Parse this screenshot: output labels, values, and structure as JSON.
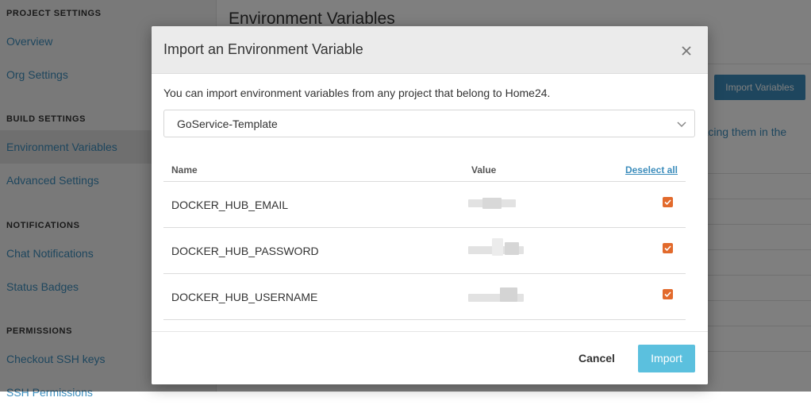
{
  "sidebar": {
    "sections": [
      {
        "title": "PROJECT SETTINGS",
        "items": [
          "Overview",
          "Org Settings"
        ]
      },
      {
        "title": "BUILD SETTINGS",
        "items": [
          "Environment Variables",
          "Advanced Settings"
        ]
      },
      {
        "title": "NOTIFICATIONS",
        "items": [
          "Chat Notifications",
          "Status Badges"
        ]
      },
      {
        "title": "PERMISSIONS",
        "items": [
          "Checkout SSH keys",
          "SSH Permissions"
        ]
      }
    ],
    "active_item": "Environment Variables"
  },
  "main": {
    "title": "Environment Variables",
    "import_button": "Import Variables",
    "description_fragment": "n placing them in the"
  },
  "modal": {
    "title": "Import an Environment Variable",
    "close_icon": "close-icon",
    "description": "You can import environment variables from any project that belong to Home24.",
    "project_select": {
      "value": "GoService-Template",
      "icon": "chevron-down-icon"
    },
    "table": {
      "columns": {
        "name": "Name",
        "value": "Value"
      },
      "deselect_all": "Deselect all",
      "rows": [
        {
          "name": "DOCKER_HUB_EMAIL",
          "value_hidden": true,
          "checked": true
        },
        {
          "name": "DOCKER_HUB_PASSWORD",
          "value_hidden": true,
          "checked": true
        },
        {
          "name": "DOCKER_HUB_USERNAME",
          "value_hidden": true,
          "checked": true
        }
      ]
    },
    "buttons": {
      "cancel": "Cancel",
      "import": "Import"
    }
  },
  "colors": {
    "link": "#3c8dbc",
    "checkbox": "#e26a2c",
    "import_button": "#5bc0de",
    "overlay": "rgba(0,0,0,0.5)"
  }
}
